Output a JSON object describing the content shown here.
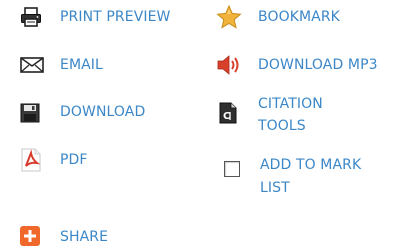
{
  "tools": {
    "print_preview": "PRINT PREVIEW",
    "bookmark": "BOOKMARK",
    "email": "EMAIL",
    "download_mp3": "DOWNLOAD MP3",
    "download": "DOWNLOAD",
    "citation_tools": "CITATION\nTOOLS",
    "pdf": "PDF",
    "add_to_mark_list": "ADD TO MARK\nLIST",
    "share": "SHARE"
  },
  "colors": {
    "link": "#3b87c8",
    "star": "#f2b33d",
    "speaker": "#d9402b",
    "pdf": "#d93a2b",
    "share": "#f0682a"
  },
  "icons": {
    "print_preview": "printer-icon",
    "bookmark": "star-icon",
    "email": "envelope-icon",
    "download_mp3": "speaker-icon",
    "download": "floppy-disk-icon",
    "citation_tools": "citation-icon",
    "pdf": "pdf-icon",
    "add_to_mark_list": "checkbox",
    "share": "plus-icon"
  }
}
